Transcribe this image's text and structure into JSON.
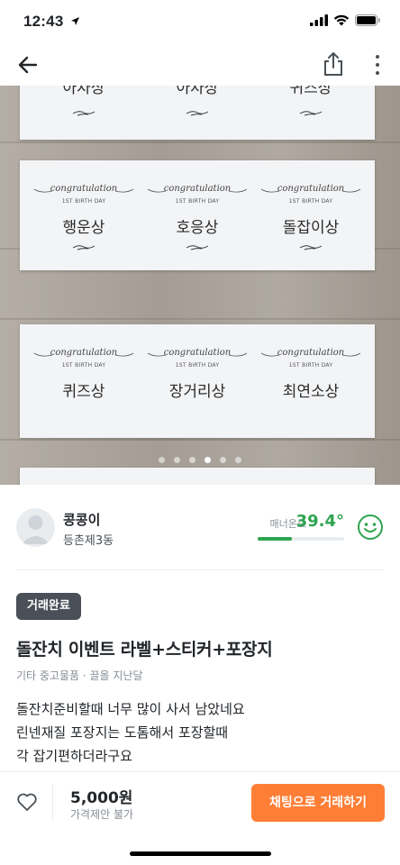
{
  "status_bar": {
    "time": "12:43",
    "location_icon": "location-arrow-icon",
    "signal_icon": "cellular-signal-icon",
    "wifi_icon": "wifi-icon",
    "battery_icon": "battery-icon"
  },
  "nav": {
    "back_icon": "arrow-left-icon",
    "share_icon": "share-icon",
    "more_icon": "more-vertical-icon"
  },
  "photo": {
    "sheets": [
      {
        "cells": [
          {
            "award": "아차상"
          },
          {
            "award": "아차상"
          },
          {
            "award": "퀴즈상"
          }
        ]
      },
      {
        "cells": [
          {
            "congrats": "congratulation",
            "subtitle": "1ST BIRTH DAY",
            "award": "행운상"
          },
          {
            "congrats": "congratulation",
            "subtitle": "1ST BIRTH DAY",
            "award": "호응상"
          },
          {
            "congrats": "congratulation",
            "subtitle": "1ST BIRTH DAY",
            "award": "돌잡이상"
          }
        ]
      },
      {
        "cells": [
          {
            "congrats": "congratulation",
            "subtitle": "1ST BIRTH DAY",
            "award": "퀴즈상"
          },
          {
            "congrats": "congratulation",
            "subtitle": "1ST BIRTH DAY",
            "award": "장거리상"
          },
          {
            "congrats": "congratulation",
            "subtitle": "1ST BIRTH DAY",
            "award": "최연소상"
          }
        ]
      }
    ],
    "page_count": 6,
    "active_page": 4
  },
  "seller": {
    "name": "콩콩이",
    "location": "등촌제3동",
    "manner_label": "매너온도",
    "manner_temp": "39.4°",
    "manner_level": 0.4,
    "manner_color": "#2ea44f",
    "face_icon": "smile-face-icon"
  },
  "post": {
    "status_badge": "거래완료",
    "title": "돌잔치 이벤트 라벨+스티커+포장지",
    "meta": "기타 중고물품 · 끌올 지난달",
    "description_lines": [
      "돌잔치준비할때 너무 많이 사서 남았네요",
      "린넨재질 포장지는 도톰해서 포장할때",
      "각 잡기편하더라구요"
    ]
  },
  "bottom": {
    "heart_icon": "heart-outline-icon",
    "price": "5,000원",
    "price_note": "가격제안 불가",
    "chat_button": "채팅으로 거래하기",
    "accent_color": "#ff7e36"
  }
}
